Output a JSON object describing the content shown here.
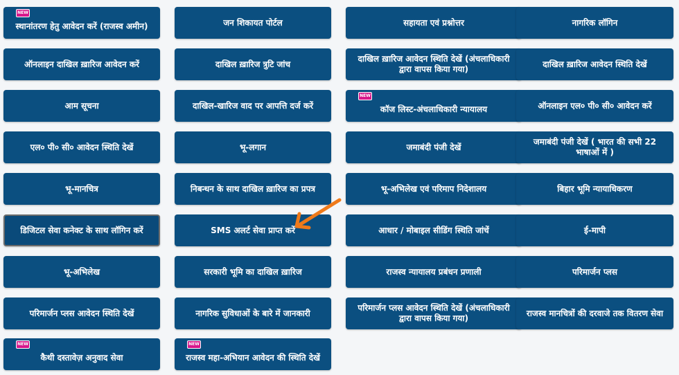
{
  "new_badge": "NEW",
  "tiles": [
    {
      "label": "स्थानांतरण हेतु आवेदन करें (राजस्व अमीन)",
      "new": true
    },
    {
      "label": "जन शिकायत पोर्टल"
    },
    {
      "label": "सहायता एवं प्रश्नोत्तर"
    },
    {
      "label": "नागरिक लॉगिन"
    },
    {
      "label": "ऑनलाइन दाखिल ख़ारिज आवेदन करें"
    },
    {
      "label": "दाखिल ख़ारिज त्रुटि जांच"
    },
    {
      "label": "दाखिल ख़ारिज आवेदन स्थिति देखें (अंचलाधिकारी द्वारा वापस किया गया)"
    },
    {
      "label": "दाखिल ख़ारिज आवेदन स्थिति देखें"
    },
    {
      "label": "आम सूचना"
    },
    {
      "label": "दाखिल-खारिज वाद पर आपत्ति दर्ज करें"
    },
    {
      "label": "कॉज लिस्ट-अंचलाधिकारी न्यायालय",
      "new": true
    },
    {
      "label": "ऑनलाइन एल० पी० सी० आवेदन करें"
    },
    {
      "label": "एल० पी० सी० आवेदन स्थिति देखें"
    },
    {
      "label": "भू-लगान"
    },
    {
      "label": "जमाबंदी पंजी देखें"
    },
    {
      "label": "जमाबंदी पंजी देखें ( भारत की सभी 22 भाषाओं में )"
    },
    {
      "label": "भू-मानचित्र"
    },
    {
      "label": "निबन्धन के साथ दाखिल ख़ारिज का प्रपत्र"
    },
    {
      "label": "भू-अभिलेख एवं परिमाप निदेशालय"
    },
    {
      "label": "बिहार भूमि न्यायाधिकरण"
    },
    {
      "label": "डिजिटल सेवा कनेक्ट के साथ लॉगिन करें"
    },
    {
      "label": "SMS अलर्ट सेवा प्राप्त करें"
    },
    {
      "label": "आधार / मोबाइल सीडिंग स्थिति जांचें"
    },
    {
      "label": "ई-मापी"
    },
    {
      "label": "भू-अभिलेख"
    },
    {
      "label": "सरकारी भूमि का दाखिल ख़ारिज"
    },
    {
      "label": "राजस्व न्यायालय प्रबंधन प्रणाली"
    },
    {
      "label": "परिमार्जन प्लस"
    },
    {
      "label": "परिमार्जन प्लस आवेदन स्थिति देखें"
    },
    {
      "label": "नागरिक सुविधाओं के बारे में जानकारी"
    },
    {
      "label": "परिमार्जन प्लस आवेदन स्थिति देखें (अंचलाधिकारी द्वारा वापस किया गया)"
    },
    {
      "label": "राजस्व मानचित्रों की दरवाजे तक वितरण सेवा"
    },
    {
      "label": "कैथी दस्तावेज़ अनुवाद सेवा",
      "new": true
    },
    {
      "label": "राजस्व महा-अभियान आवेदन की स्थिति देखें",
      "new": true
    }
  ],
  "colors": {
    "tile": "#0b4f80",
    "arrow": "#ef7a1a",
    "badge": "#d6178b"
  }
}
